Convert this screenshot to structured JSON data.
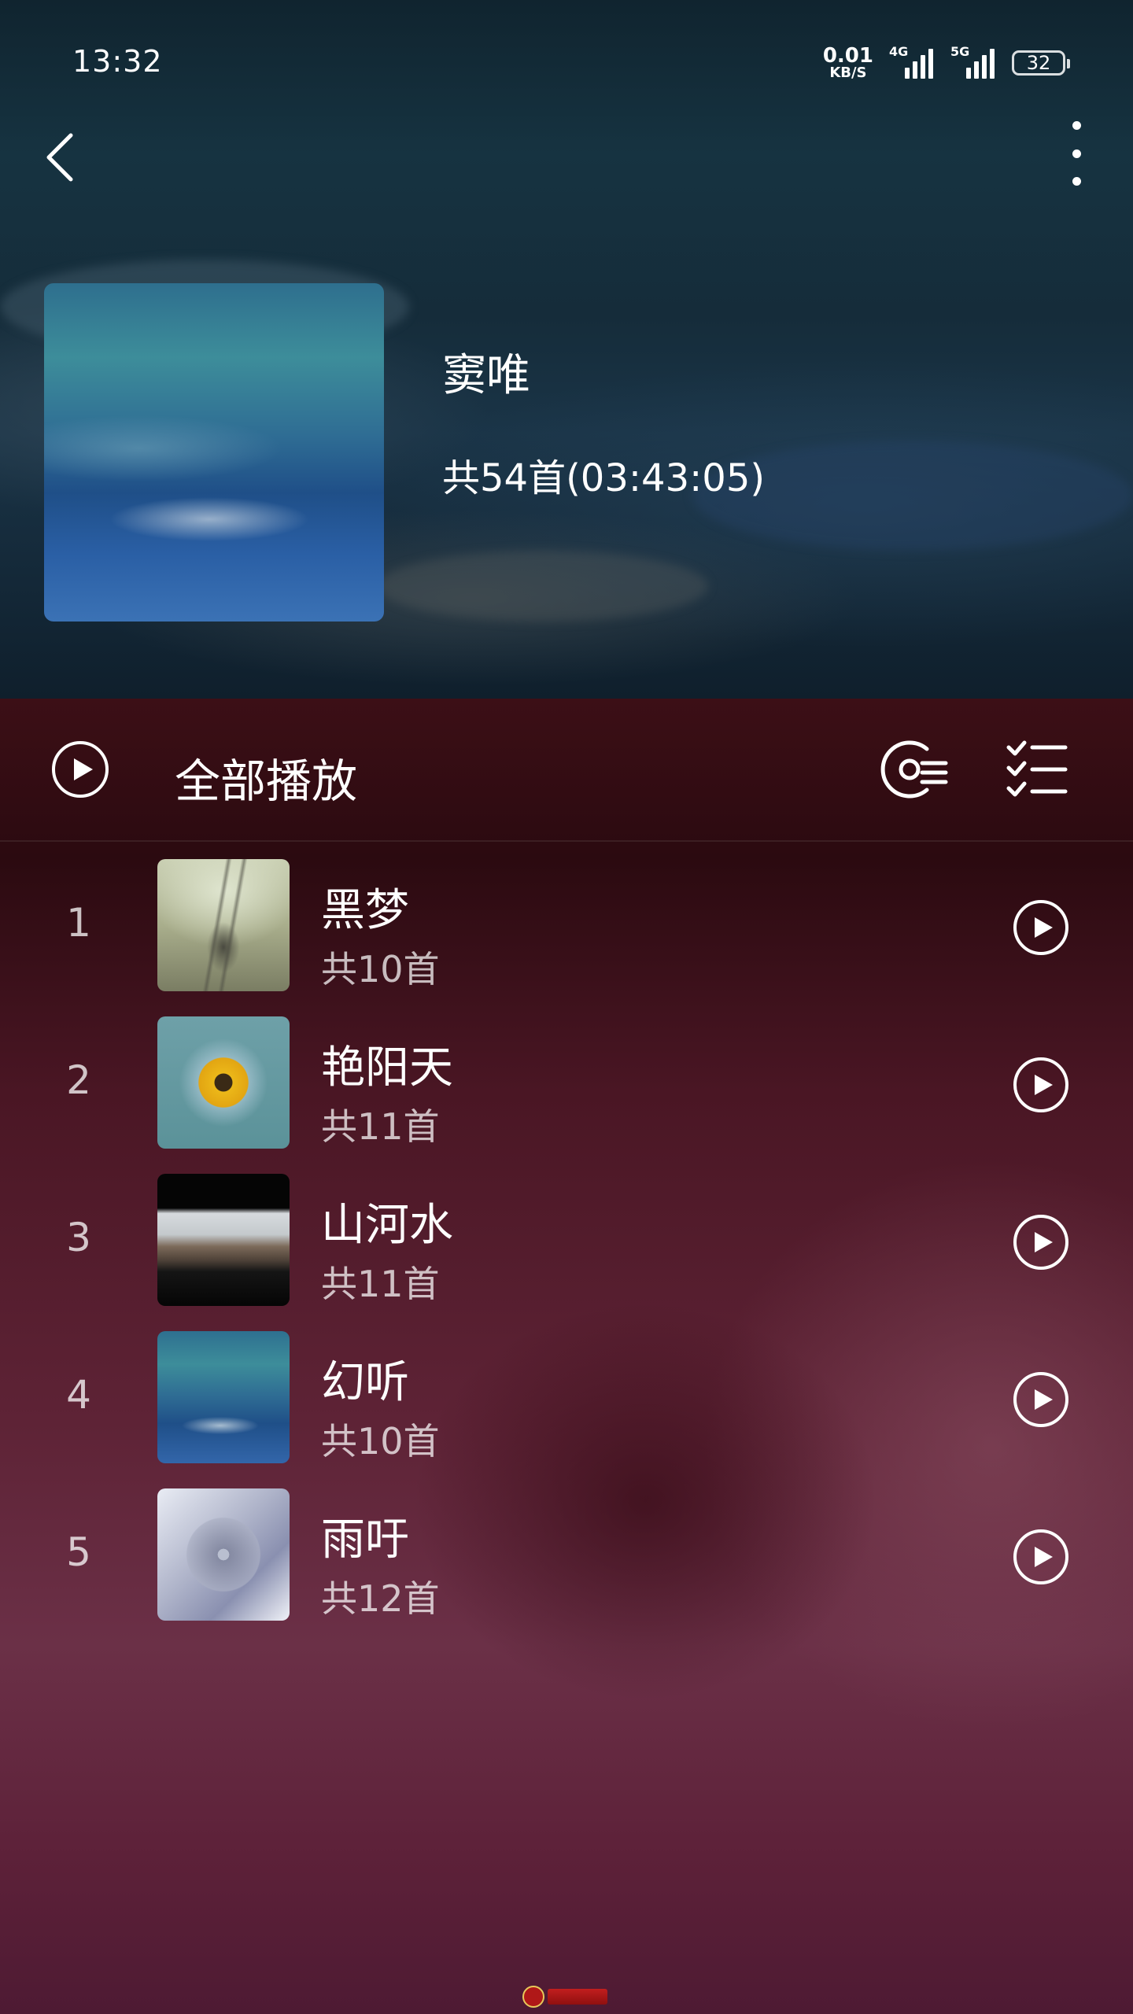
{
  "status_bar": {
    "time": "13:32",
    "net_speed_value": "0.01",
    "net_speed_unit": "KB/S",
    "signal_1_label": "4G",
    "signal_2_label": "5G",
    "battery": "32"
  },
  "nav": {
    "back_icon": "chevron-left-icon",
    "more_icon": "more-vertical-icon"
  },
  "artist": {
    "name": "窦唯",
    "stats": "共54首(03:43:05)"
  },
  "actions": {
    "play_all_label": "全部播放",
    "play_all_icon": "play-circle-icon",
    "add_to_playlist_icon": "playlist-add-icon",
    "multi_select_icon": "checklist-icon"
  },
  "albums": [
    {
      "index": "1",
      "title": "黑梦",
      "count": "共10首"
    },
    {
      "index": "2",
      "title": "艳阳天",
      "count": "共11首"
    },
    {
      "index": "3",
      "title": "山河水",
      "count": "共11首"
    },
    {
      "index": "4",
      "title": "幻听",
      "count": "共10首"
    },
    {
      "index": "5",
      "title": "雨吁",
      "count": "共12首"
    }
  ],
  "colors": {
    "header_bg": "#163341",
    "body_bg": "#4a1624",
    "text": "#ffffff"
  }
}
